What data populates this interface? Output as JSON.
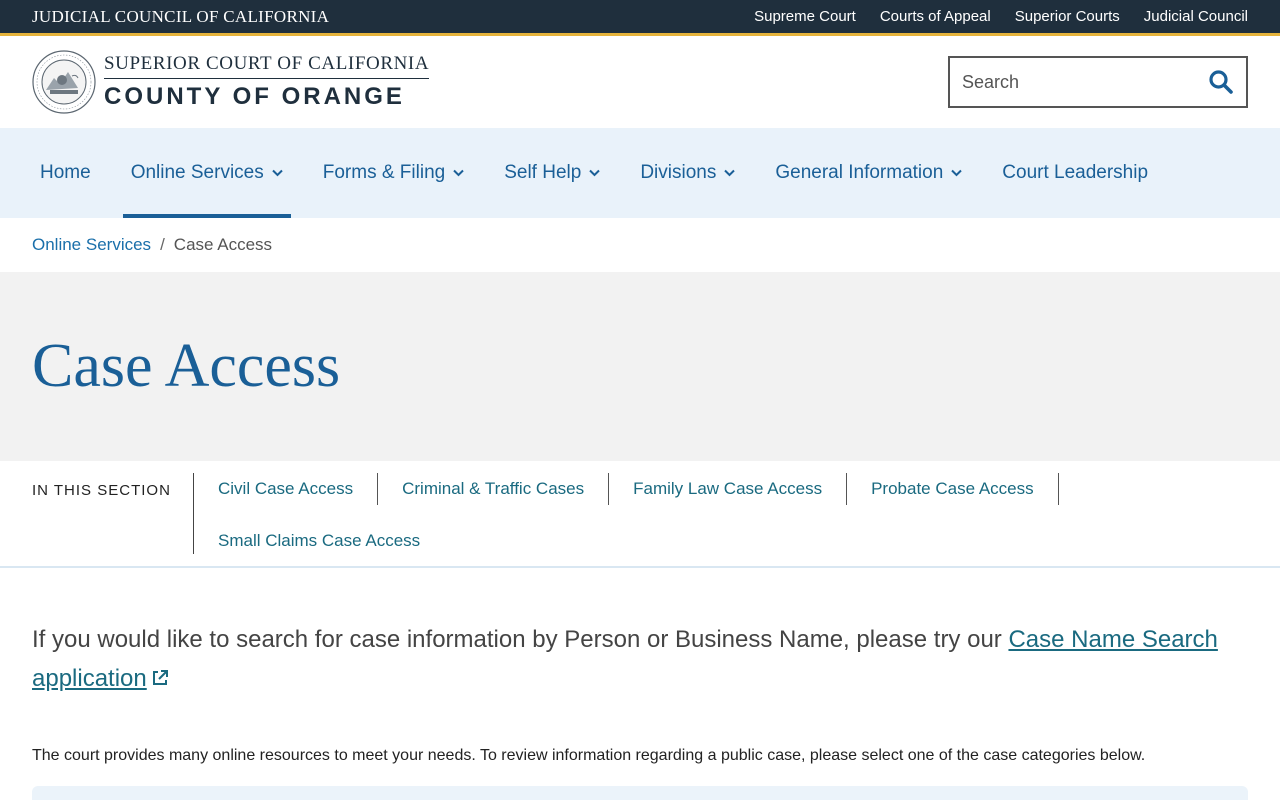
{
  "topbar": {
    "council": "JUDICIAL COUNCIL OF CALIFORNIA",
    "links": [
      "Supreme Court",
      "Courts of Appeal",
      "Superior Courts",
      "Judicial Council"
    ]
  },
  "header": {
    "logo_line1": "SUPERIOR COURT OF CALIFORNIA",
    "logo_line2": "COUNTY OF ORANGE",
    "seal_icon": "court-seal-icon",
    "search": {
      "placeholder": "Search",
      "icon": "search-icon"
    }
  },
  "nav": {
    "items": [
      {
        "label": "Home",
        "dropdown": false
      },
      {
        "label": "Online Services",
        "dropdown": true,
        "active": true
      },
      {
        "label": "Forms & Filing",
        "dropdown": true
      },
      {
        "label": "Self Help",
        "dropdown": true
      },
      {
        "label": "Divisions",
        "dropdown": true
      },
      {
        "label": "General Information",
        "dropdown": true
      },
      {
        "label": "Court Leadership",
        "dropdown": false
      }
    ]
  },
  "breadcrumb": {
    "parent": "Online Services",
    "separator": "/",
    "current": "Case Access"
  },
  "page": {
    "title": "Case Access"
  },
  "section_nav": {
    "label": "IN THIS SECTION",
    "links": [
      "Civil Case Access",
      "Criminal & Traffic Cases",
      "Family Law Case Access",
      "Probate Case Access",
      "Small Claims Case Access"
    ]
  },
  "content": {
    "lead_text": "If you would like to search for case information by Person or Business Name, please try our ",
    "lead_link": "Case Name Search application",
    "paragraph": "The court provides many online resources to meet your needs. To review information regarding a public case, please select one of the case categories below."
  },
  "colors": {
    "topbar_bg": "#1f2f3d",
    "accent_gold": "#e5b33b",
    "brand_blue": "#1a5f97",
    "nav_bg": "#e9f2fa",
    "hero_bg": "#f2f2f2"
  }
}
